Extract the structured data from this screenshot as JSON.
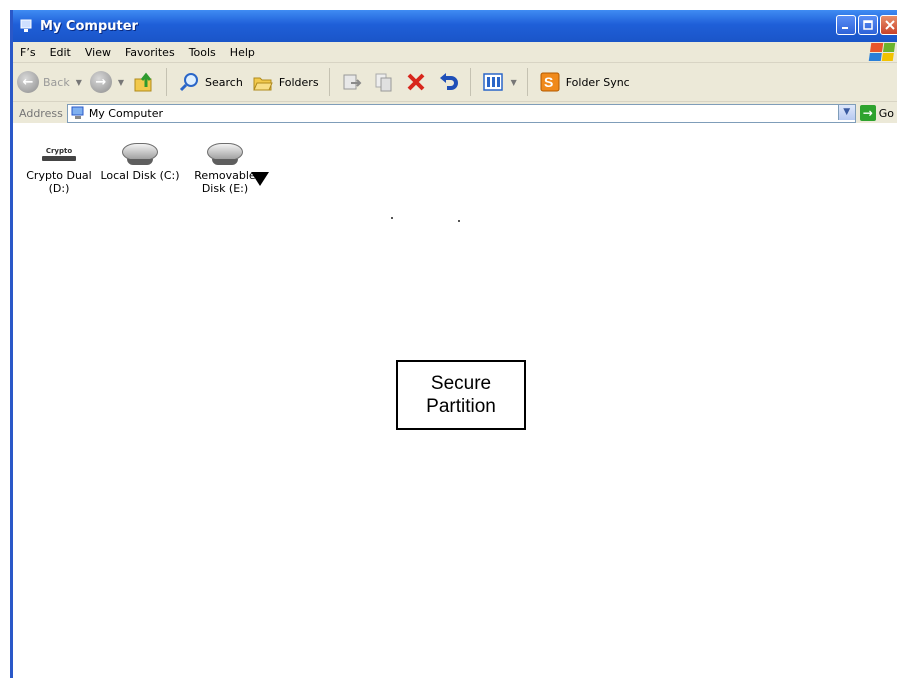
{
  "window": {
    "title": "My Computer",
    "title_icon": "computer-icon",
    "controls": [
      "minimize",
      "maximize",
      "close"
    ]
  },
  "menu": {
    "items": [
      "F’s",
      "Edit",
      "View",
      "Favorites",
      "Tools",
      "Help"
    ]
  },
  "toolbar": {
    "back_label": "Back",
    "search_label": "Search",
    "folders_label": "Folders",
    "folder_sync_label": "Folder Sync"
  },
  "address": {
    "label": "Address",
    "value": "My Computer",
    "go_label": "Go"
  },
  "drives": [
    {
      "label": "Crypto Dual (D:)",
      "icon": "crypto-drive-icon",
      "logo_text": "Crypto"
    },
    {
      "label": "Local Disk (C:)",
      "icon": "hard-disk-icon"
    },
    {
      "label": "Removable Disk (E:)",
      "icon": "removable-disk-icon"
    }
  ],
  "callout": {
    "text": "Secure\nPartition"
  },
  "colors": {
    "titlebar": "#1f5fd8",
    "chrome": "#ece9d8",
    "close_button": "#c9422a",
    "go_arrow": "#2ea32e"
  }
}
